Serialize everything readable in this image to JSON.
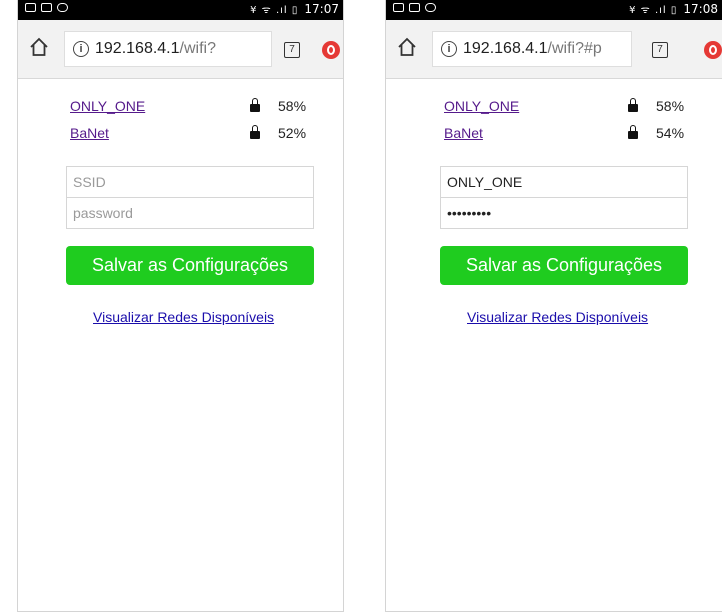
{
  "screens": [
    {
      "status": {
        "time": "17:07",
        "signal_icons": "¥ ᯤ .ıl ▯"
      },
      "address_bar": {
        "host": "192.168.4.1",
        "path": "/wifi?"
      },
      "tabs_count": "7",
      "networks": [
        {
          "ssid": "ONLY_ONE",
          "signal": "58%"
        },
        {
          "ssid": "BaNet",
          "signal": "52%"
        }
      ],
      "form": {
        "ssid_value": "",
        "ssid_placeholder": "SSID",
        "password_value": "",
        "password_placeholder": "password",
        "save_label": "Salvar as Configurações"
      },
      "view_networks_link": "Visualizar Redes Disponíveis"
    },
    {
      "status": {
        "time": "17:08",
        "signal_icons": "¥ ᯤ .ıl ▯"
      },
      "address_bar": {
        "host": "192.168.4.1",
        "path": "/wifi?#p"
      },
      "tabs_count": "7",
      "networks": [
        {
          "ssid": "ONLY_ONE",
          "signal": "58%"
        },
        {
          "ssid": "BaNet",
          "signal": "54%"
        }
      ],
      "form": {
        "ssid_value": "ONLY_ONE",
        "ssid_placeholder": "SSID",
        "password_value": "•••••••••",
        "password_placeholder": "password",
        "save_label": "Salvar as Configurações"
      },
      "view_networks_link": "Visualizar Redes Disponíveis"
    }
  ],
  "colors": {
    "save_button": "#1fcc1f",
    "visited_link": "#551a8b",
    "link": "#1a0dab",
    "opera_red": "#e53935"
  }
}
